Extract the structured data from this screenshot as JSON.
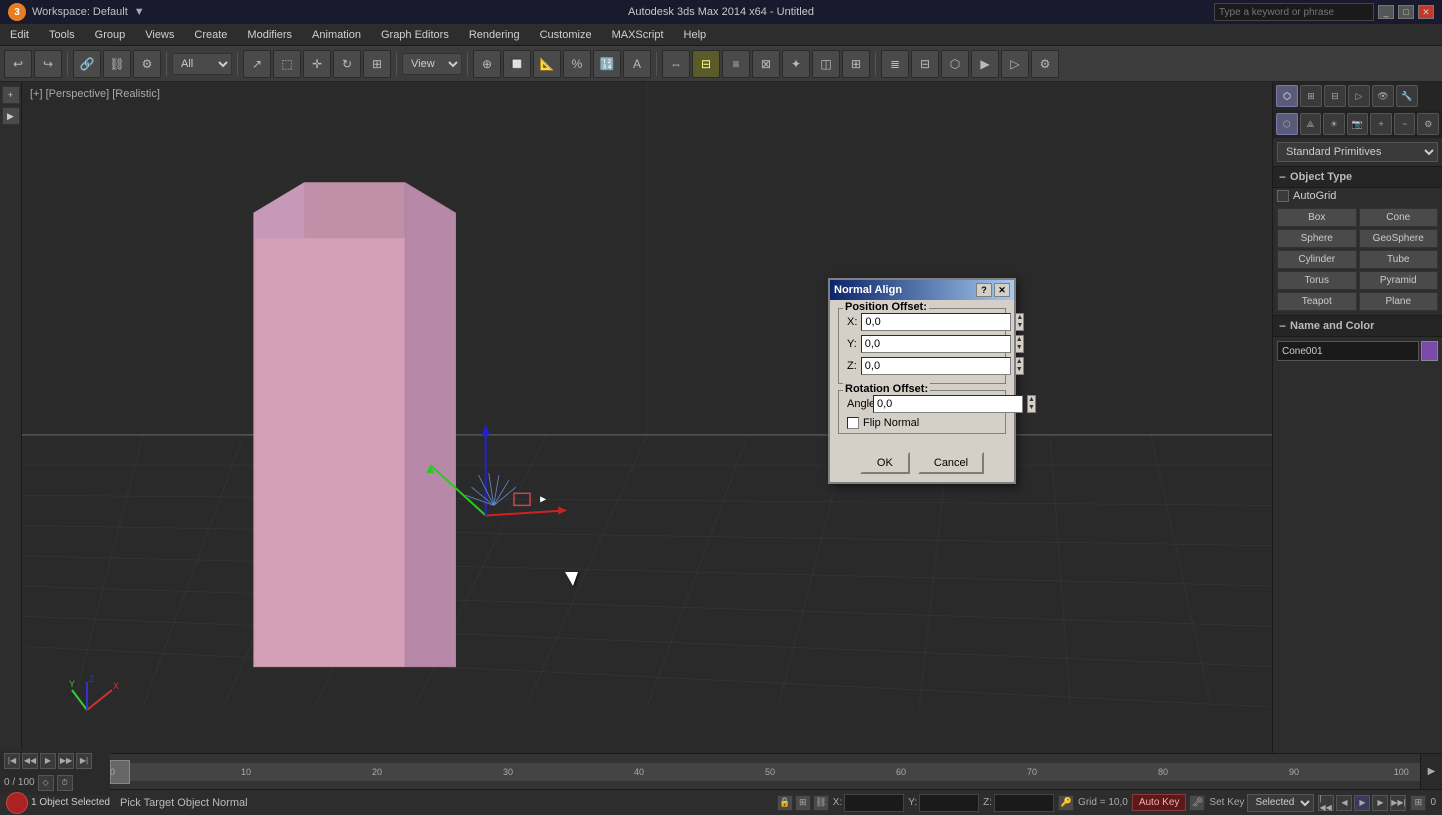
{
  "titlebar": {
    "workspace": "Workspace: Default",
    "title": "Autodesk 3ds Max 2014 x64 - Untitled",
    "search_placeholder": "Type a keyword or phrase"
  },
  "menubar": {
    "items": [
      "Edit",
      "Tools",
      "Group",
      "Views",
      "Create",
      "Modifiers",
      "Animation",
      "Graph Editors",
      "Rendering",
      "Customize",
      "MAXScript",
      "Help"
    ]
  },
  "viewport": {
    "label": "[+] [Perspective] [Realistic]"
  },
  "dialog": {
    "title": "Normal Align",
    "position_offset_label": "Position Offset:",
    "x_label": "X:",
    "y_label": "Y:",
    "z_label": "Z:",
    "x_value": "0,0",
    "y_value": "0,0",
    "z_value": "0,0",
    "rotation_offset_label": "Rotation Offset:",
    "angle_label": "Angle:",
    "angle_value": "0,0",
    "flip_normal_label": "Flip Normal",
    "ok_label": "OK",
    "cancel_label": "Cancel"
  },
  "right_panel": {
    "dropdown_value": "Standard Primitives",
    "section_object_type": "Object Type",
    "autogrid_label": "AutoGrid",
    "buttons": [
      "Box",
      "Cone",
      "Sphere",
      "GeoSphere",
      "Cylinder",
      "Tube",
      "Torus",
      "Pyramid",
      "Teapot",
      "Plane"
    ],
    "section_name_color": "Name and Color",
    "name_value": "Cone001"
  },
  "status_bar": {
    "objects_selected": "1 Object Selected",
    "status_msg": "Pick Target Object Normal",
    "x_label": "X:",
    "y_label": "Y:",
    "z_label": "Z:",
    "grid_info": "Grid = 10,0",
    "autokey_label": "Auto Key",
    "selected_label": "Selected",
    "setkey_label": "Set Key"
  },
  "timeline": {
    "position": "0 / 100",
    "numbers": [
      "0",
      "10",
      "20",
      "30",
      "40",
      "50",
      "60",
      "70",
      "80",
      "90",
      "100"
    ]
  }
}
